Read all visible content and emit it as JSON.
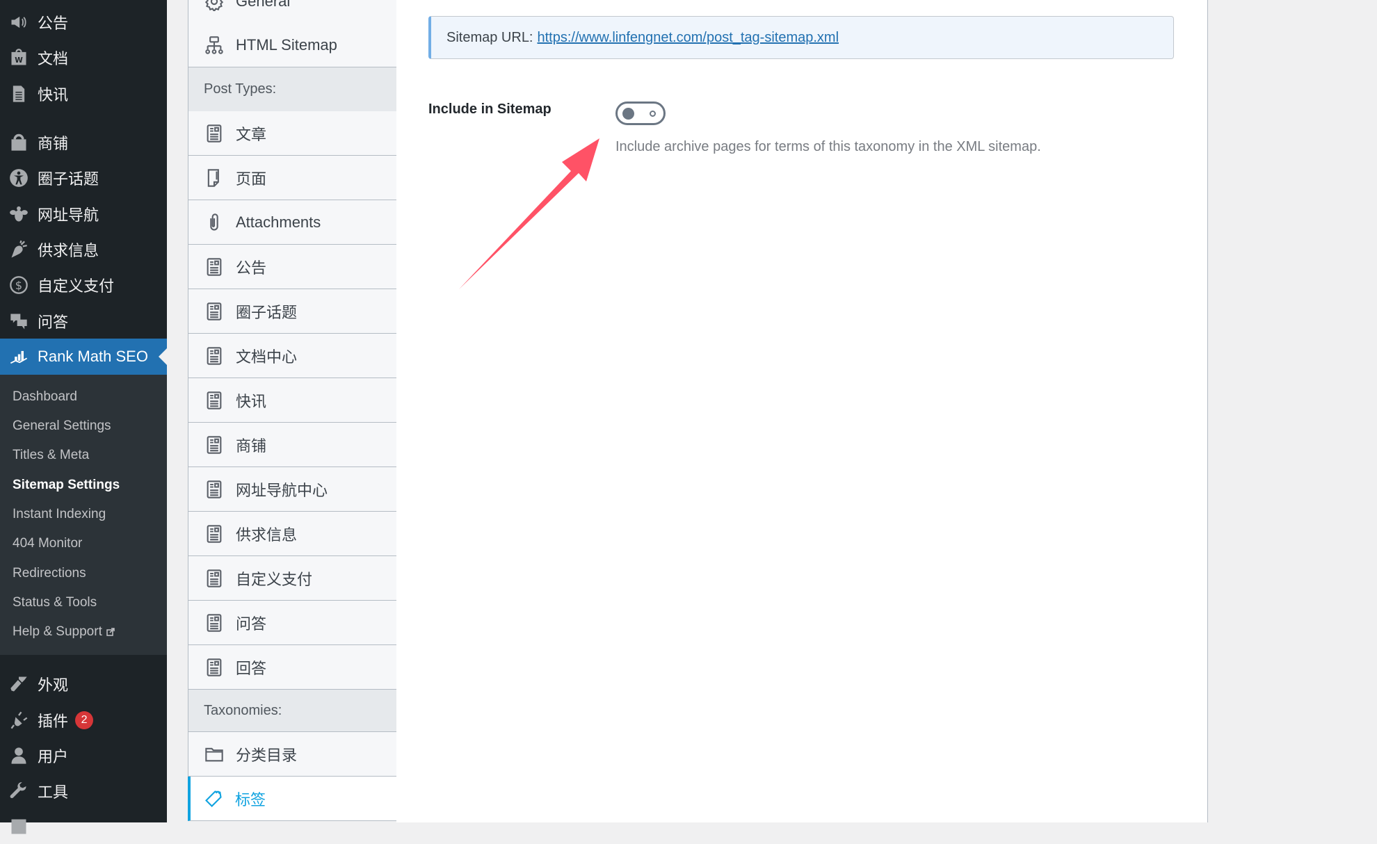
{
  "admin_menu": {
    "items_top": [
      {
        "label": "公告",
        "icon": "megaphone-icon"
      },
      {
        "label": "文档",
        "icon": "docs-icon"
      },
      {
        "label": "快讯",
        "icon": "news-icon"
      },
      {
        "label": "商铺",
        "icon": "shop-bag-icon"
      },
      {
        "label": "圈子话题",
        "icon": "universal-access-icon"
      },
      {
        "label": "网址导航",
        "icon": "bee-icon"
      },
      {
        "label": "供求信息",
        "icon": "carrot-icon"
      },
      {
        "label": "自定义支付",
        "icon": "dollar-icon"
      },
      {
        "label": "问答",
        "icon": "chat-bubbles-icon"
      }
    ],
    "active": {
      "label": "Rank Math SEO",
      "icon": "rank-math-icon"
    },
    "submenu": [
      {
        "label": "Dashboard"
      },
      {
        "label": "General Settings"
      },
      {
        "label": "Titles & Meta"
      },
      {
        "label": "Sitemap Settings",
        "current": true
      },
      {
        "label": "Instant Indexing"
      },
      {
        "label": "404 Monitor"
      },
      {
        "label": "Redirections"
      },
      {
        "label": "Status & Tools"
      },
      {
        "label": "Help & Support",
        "external": true
      }
    ],
    "items_bottom": [
      {
        "label": "外观",
        "icon": "paintbrush-icon"
      },
      {
        "label": "插件",
        "icon": "plugin-icon",
        "badge": "2"
      },
      {
        "label": "用户",
        "icon": "user-icon"
      },
      {
        "label": "工具",
        "icon": "wrench-icon"
      }
    ]
  },
  "tabs": {
    "general": "General",
    "html_sitemap": "HTML Sitemap",
    "post_types_header": "Post Types:",
    "post_types": [
      "文章",
      "页面",
      "Attachments",
      "公告",
      "圈子话题",
      "文档中心",
      "快讯",
      "商铺",
      "网址导航中心",
      "供求信息",
      "自定义支付",
      "问答",
      "回答"
    ],
    "taxonomies_header": "Taxonomies:",
    "taxonomies": [
      "分类目录",
      "标签"
    ],
    "active_tab": "标签"
  },
  "main": {
    "sitemap_url_label": "Sitemap URL:",
    "sitemap_url": "https://www.linfengnet.com/post_tag-sitemap.xml",
    "include_label": "Include in Sitemap",
    "include_toggle_on": false,
    "include_desc": "Include archive pages for terms of this taxonomy in the XML sitemap."
  },
  "colors": {
    "admin_active": "#2271b1",
    "tab_active": "#10a3e0",
    "annotation_arrow": "#ff5266",
    "badge": "#d63638"
  }
}
